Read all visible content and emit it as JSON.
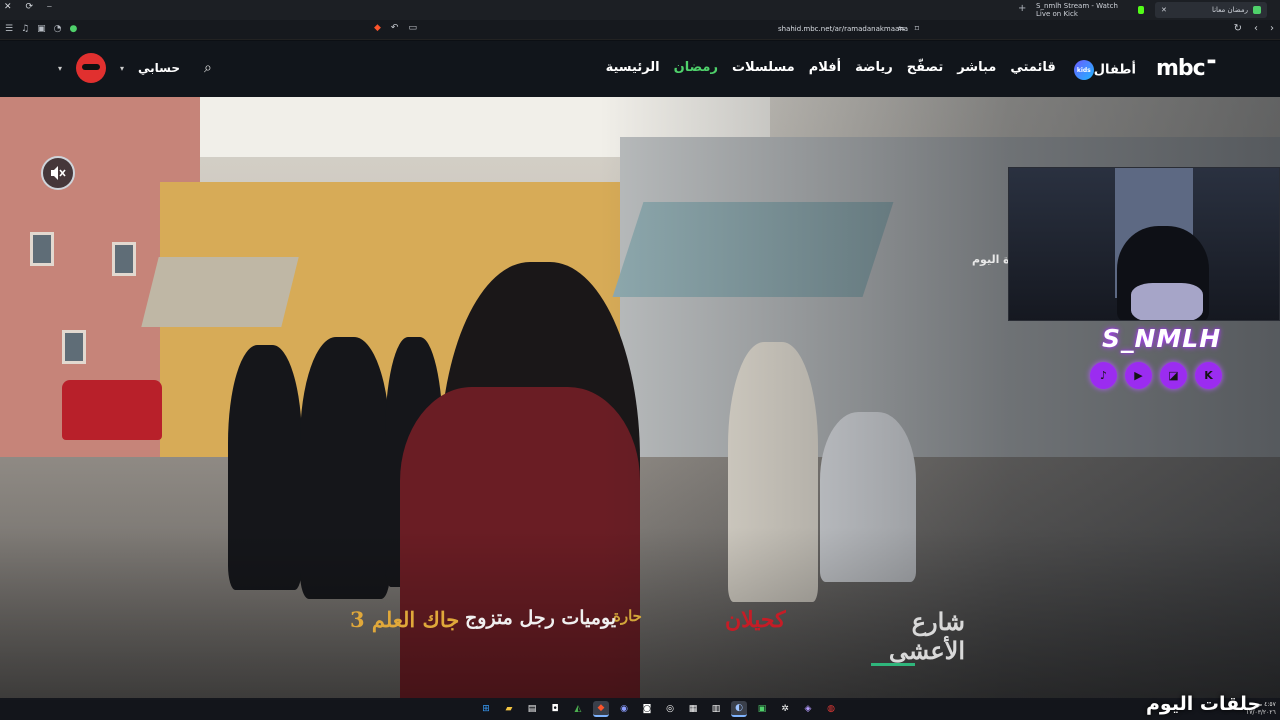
{
  "browser": {
    "tabs": [
      {
        "title": "S_nmlh Stream - Watch Live on Kick",
        "favicon_color": "#53fc18"
      },
      {
        "title": "رمضان معانا",
        "favicon_color": "#4fd16b"
      }
    ],
    "new_tab": "+",
    "url": "shahid.mbc.net/ar/ramadanakmaana",
    "window_controls": [
      "✕",
      "⟳",
      "⎯"
    ]
  },
  "site": {
    "logo": "mbc",
    "nav": [
      {
        "label": "الرئيسية",
        "active": false
      },
      {
        "label": "رمضان",
        "active": true
      },
      {
        "label": "مسلسلات",
        "active": false
      },
      {
        "label": "أفلام",
        "active": false
      },
      {
        "label": "رياضة",
        "active": false
      },
      {
        "label": "تصفّح",
        "active": false
      },
      {
        "label": "مباشر",
        "active": false
      },
      {
        "label": "قائمتي",
        "active": false
      },
      {
        "label": "أطفال",
        "active": false
      }
    ],
    "kids_badge": "kids",
    "account_label": "حسابي",
    "accent_color": "#4fd16b"
  },
  "hero": {
    "side_title": "ة اليوم",
    "mute_icon": "volume-muted-icon"
  },
  "stream": {
    "streamer_name": "S_NMLH",
    "socials": [
      {
        "name": "tiktok-icon",
        "glyph": "♪"
      },
      {
        "name": "youtube-icon",
        "glyph": "▶"
      },
      {
        "name": "twitch-icon",
        "glyph": "◪"
      },
      {
        "name": "kick-icon",
        "glyph": "K"
      }
    ],
    "brand_color": "#9b2cf0"
  },
  "shows": [
    {
      "title": "شارع الأعشى"
    },
    {
      "title": "كحيلان"
    },
    {
      "title": "حارة"
    },
    {
      "title": "يوميات رجل متزوج"
    },
    {
      "title": "جاك العلم 3"
    }
  ],
  "overlay_text": "حلقات اليوم",
  "taskbar": {
    "icons": [
      "windows-icon",
      "folder-icon",
      "files-icon",
      "store-icon",
      "maps-icon",
      "brave-icon",
      "discord-icon",
      "media-icon",
      "chrome-icon",
      "photos-icon",
      "terminal-icon",
      "steam-icon",
      "lock-icon",
      "settings-icon",
      "app-icon",
      "obs-icon"
    ],
    "clock_time": "٤:٥٧ ص",
    "clock_date": "١٧/٠٣/٢٠٢٦"
  }
}
